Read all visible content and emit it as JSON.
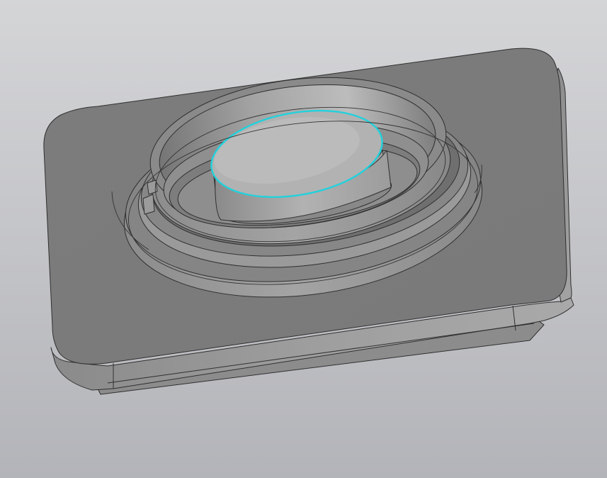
{
  "viewport": {
    "background_top": "#d3d4d6",
    "background_bottom": "#b4b5ba"
  },
  "model": {
    "part_color": "#7b7b7b",
    "edge_color": "#2f2f2f",
    "selection_color": "#22d1dc",
    "selected_edge": "inner-bore-top-edge"
  }
}
